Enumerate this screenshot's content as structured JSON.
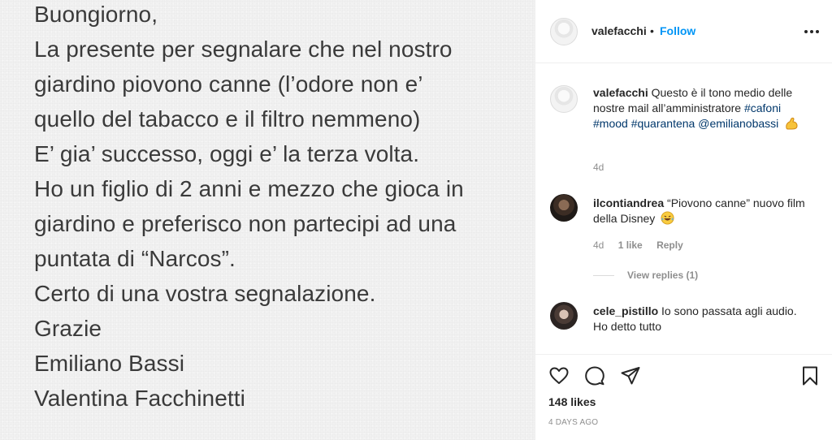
{
  "post": {
    "letter_lines": [
      "Buongiorno,",
      "La presente per segnalare che nel nostro",
      "giardino piovono canne (l’odore non e’",
      "quello del tabacco e il filtro nemmeno)",
      "E’ gia’ successo, oggi e’ la terza volta.",
      "Ho un figlio di 2 anni e mezzo che gioca in",
      "giardino e preferisco non partecipi ad una",
      "puntata di “Narcos”.",
      "Certo di una vostra segnalazione.",
      "Grazie",
      "Emiliano Bassi",
      "Valentina Facchinetti"
    ]
  },
  "header": {
    "username": "valefacchi",
    "separator": "•",
    "follow_label": "Follow",
    "more_icon": "more-horizontal-icon"
  },
  "caption": {
    "username": "valefacchi",
    "text": "Questo è il tono medio delle nostre mail all’amministratore",
    "hashtags": [
      "#cafoni",
      "#mood",
      "#quarantena"
    ],
    "mention": "@emilianobassi",
    "emoji": "flexed-biceps",
    "time": "4d"
  },
  "comments": [
    {
      "username": "ilcontiandrea",
      "text": "“Piovono canne” nuovo film della Disney",
      "emoji": "laughing-tears",
      "time": "4d",
      "likes": "1 like",
      "reply_label": "Reply",
      "view_replies": "View replies (1)"
    },
    {
      "username": "cele_pistillo",
      "text": "Io sono passata agli audio. Ho detto tutto"
    }
  ],
  "actions": {
    "icons": [
      "heart-icon",
      "comment-icon",
      "share-icon",
      "bookmark-icon"
    ],
    "likes": "148 likes",
    "date": "4 DAYS AGO"
  },
  "colors": {
    "link_blue": "#0095f6",
    "tag_blue": "#00376b",
    "muted": "#8e8e8e",
    "text": "#262626"
  }
}
